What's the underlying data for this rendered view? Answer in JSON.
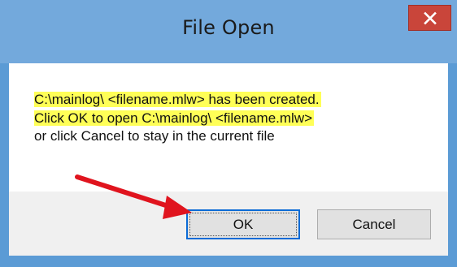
{
  "dialog": {
    "title": "File Open",
    "message": {
      "line1": "C:\\mainlog\\ <filename.mlw>  has been created.",
      "line2": "Click OK to open C:\\mainlog\\ <filename.mlw>",
      "line3": "or click Cancel to stay in the current file"
    },
    "ok_label": "OK",
    "cancel_label": "Cancel"
  },
  "icons": {
    "close": "close-icon",
    "arrow": "arrow-annotation-icon"
  },
  "colors": {
    "title_bar": "#73a9dc",
    "close_button": "#c9453a",
    "highlight": "#ffff57",
    "annotation_arrow": "#e0141e",
    "focus_border": "#0b6bd6"
  }
}
